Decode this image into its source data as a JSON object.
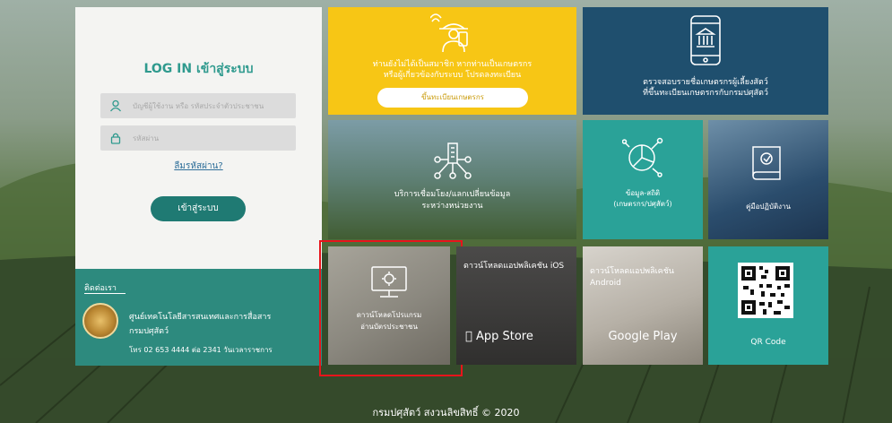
{
  "login": {
    "title": "LOG IN เข้าสู่ระบบ",
    "username_placeholder": "บัญชีผู้ใช้งาน หรือ รหัสประจำตัวประชาชน",
    "password_placeholder": "รหัสผ่าน",
    "forgot_label": "ลืมรหัสผ่าน?",
    "submit_label": "เข้าสู่ระบบ"
  },
  "contact": {
    "label": "ติดต่อเรา",
    "org_line1": "ศูนย์เทคโนโลยีสารสนเทศและการสื่อสาร",
    "org_line2": "กรมปศุสัตว์",
    "phone": "โทร 02 653 4444 ต่อ 2341 วันเวลาราชการ"
  },
  "tiles": {
    "register": {
      "line1": "ท่านยังไม่ได้เป็นสมาชิก หากท่านเป็นเกษตรกร",
      "line2": "หรือผู้เกี่ยวข้องกับระบบ โปรดลงทะเบียน",
      "button": "ขึ้นทะเบียนเกษตรกร"
    },
    "check": {
      "line1": "ตรวจสอบรายชื่อเกษตรกรผู้เลี้ยงสัตว์",
      "line2": "ที่ขึ้นทะเบียนเกษตรกรกับกรมปศุสัตว์"
    },
    "services": {
      "line1": "บริการเชื่อมโยง/แลกเปลี่ยนข้อมูล",
      "line2": "ระหว่างหน่วยงาน"
    },
    "stats": {
      "line1": "ข้อมูล-สถิติ",
      "line2": "(เกษตรกร/ปศุสัตว์)"
    },
    "manual": {
      "label": "คู่มือปฏิบัติงาน"
    },
    "download": {
      "line1": "ดาวน์โหลดโปรแกรม",
      "line2": "อ่านบัตรประชาชน"
    },
    "ios": {
      "label": "ดาวน์โหลดแอปพลิเคชัน iOS",
      "store": "App Store"
    },
    "android": {
      "label": "ดาวน์โหลดแอปพลิเคชัน Android",
      "store": "Google Play"
    },
    "qr": {
      "label": "QR Code"
    }
  },
  "footer": {
    "text": "กรมปศุสัตว์ สงวนลิขสิทธิ์ © 2020"
  },
  "colors": {
    "teal": "#2aa298",
    "dark_teal": "#1f7a73",
    "yellow": "#f7c615",
    "navy": "#1f4f6e",
    "highlight": "#e8141b"
  }
}
